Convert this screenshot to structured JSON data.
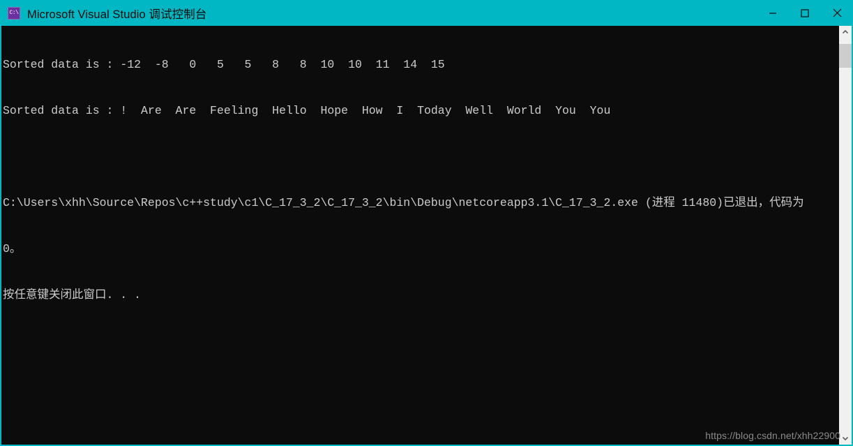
{
  "window": {
    "title": "Microsoft Visual Studio 调试控制台",
    "icon": "console-app-icon",
    "accent_color": "#00b7c3",
    "console_background": "#0c0c0c",
    "console_foreground": "#cccccc"
  },
  "window_controls": {
    "minimize_label": "最小化",
    "maximize_label": "最大化",
    "close_label": "关闭"
  },
  "console": {
    "lines": [
      "Sorted data is : -12  -8   0   5   5   8   8  10  10  11  14  15",
      "Sorted data is : !  Are  Are  Feeling  Hello  Hope  How  I  Today  Well  World  You  You",
      "",
      "C:\\Users\\xhh\\Source\\Repos\\c++study\\c1\\C_17_3_2\\C_17_3_2\\bin\\Debug\\netcoreapp3.1\\C_17_3_2.exe (进程 11480)已退出，代码为",
      "0。",
      "按任意键关闭此窗口. . ."
    ],
    "sorted_numbers": [
      -12,
      -8,
      0,
      5,
      5,
      8,
      8,
      10,
      10,
      11,
      14,
      15
    ],
    "sorted_words": [
      "!",
      "Are",
      "Are",
      "Feeling",
      "Hello",
      "Hope",
      "How",
      "I",
      "Today",
      "Well",
      "World",
      "You",
      "You"
    ],
    "executable_path": "C:\\Users\\xhh\\Source\\Repos\\c++study\\c1\\C_17_3_2\\C_17_3_2\\bin\\Debug\\netcoreapp3.1\\C_17_3_2.exe",
    "process_id": "11480",
    "exit_code": "0",
    "prompt": "按任意键关闭此窗口. . ."
  },
  "scrollbar": {
    "up_arrow": "chevron-up-icon",
    "down_arrow": "chevron-down-icon"
  },
  "watermark": {
    "text": "https://blog.csdn.net/xhh22900"
  }
}
